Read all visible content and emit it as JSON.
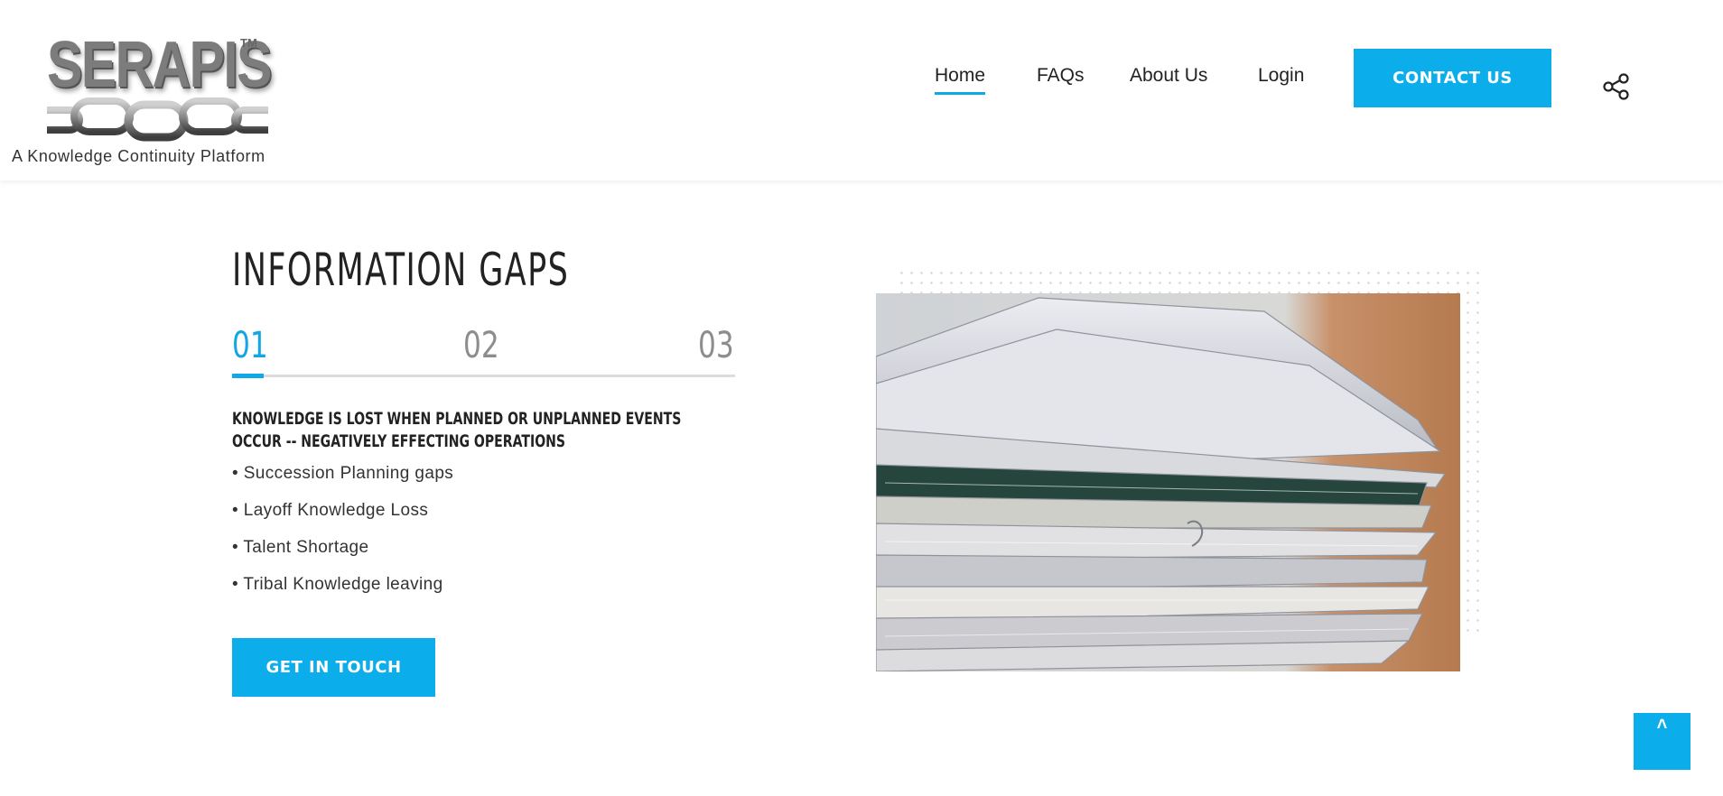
{
  "brand": {
    "logo_text": "SERAPIS",
    "trademark": "TM",
    "tagline": "A Knowledge Continuity Platform"
  },
  "nav": {
    "items": [
      {
        "label": "Home",
        "active": true
      },
      {
        "label": "FAQs",
        "active": false
      },
      {
        "label": "About Us",
        "active": false
      },
      {
        "label": "Login",
        "active": false
      }
    ],
    "contact_label": "CONTACT US",
    "share_icon": "share-icon"
  },
  "section": {
    "title": "INFORMATION GAPS",
    "steps": [
      "01",
      "02",
      "03"
    ],
    "active_step": "01",
    "subheading": "KNOWLEDGE IS LOST WHEN PLANNED OR UNPLANNED EVENTS OCCUR -- NEGATIVELY EFFECTING OPERATIONS",
    "bullets": [
      "• Succession Planning gaps",
      "• Layoff Knowledge Loss",
      "• Talent Shortage",
      "• Tribal Knowledge leaving"
    ],
    "cta_label": "GET IN TOUCH"
  },
  "colors": {
    "accent": "#0cadeb",
    "text": "#222222",
    "step_inactive": "#8d8d8d"
  },
  "scroll_top_icon": "chevron-up-icon",
  "scroll_top_glyph": "˄"
}
